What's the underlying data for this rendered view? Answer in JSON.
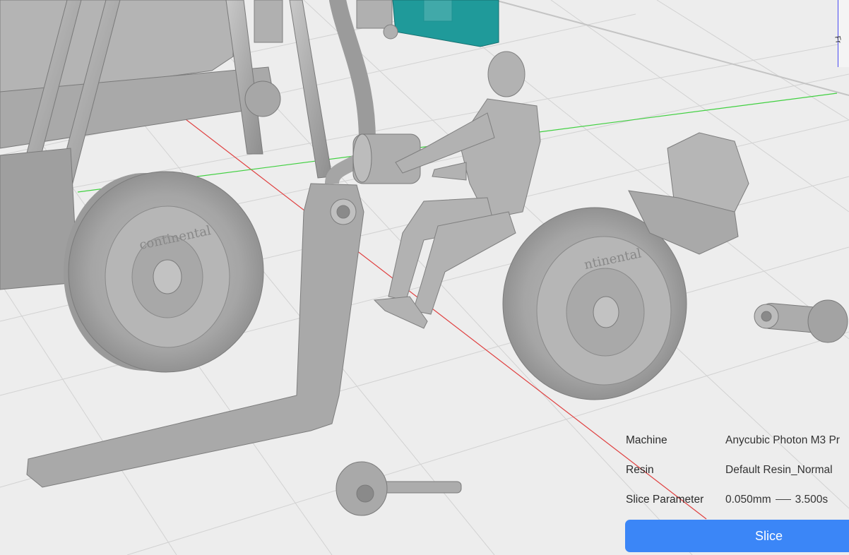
{
  "info": {
    "machine_label": "Machine",
    "machine_value": "Anycubic Photon M3 Pr",
    "resin_label": "Resin",
    "resin_value": "Default Resin_Normal",
    "slice_param_label": "Slice Parameter",
    "layer_height": "0.050mm",
    "exposure": "3.500s"
  },
  "slice_button": "Slice",
  "tire_brand": "ntinental",
  "view_cube_label": "Fr",
  "colors": {
    "background": "#ededed",
    "model": "#a9a9a9",
    "selected_model": "#1f9a9a",
    "x_axis": "#e04040",
    "y_axis": "#40d040",
    "button": "#3b86f7"
  }
}
